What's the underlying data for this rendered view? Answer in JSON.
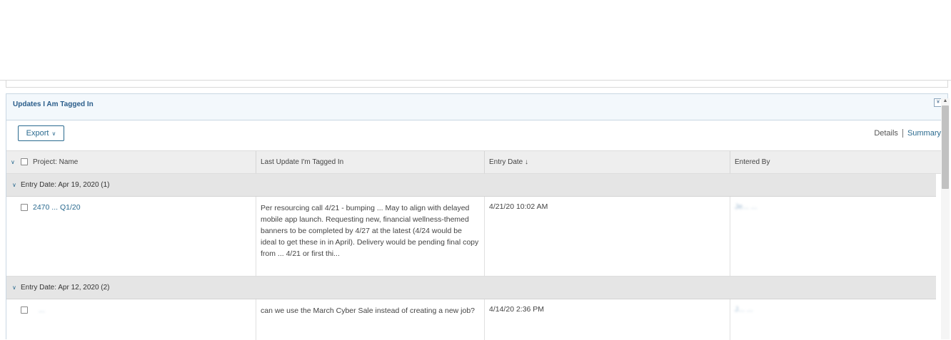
{
  "panel": {
    "title": "Updates I Am Tagged In",
    "collapse_icon": "double-chevron-up-icon"
  },
  "toolbar": {
    "export_label": "Export",
    "details_label": "Details",
    "summary_label": "Summary"
  },
  "grid": {
    "columns": [
      {
        "label": "Project: Name"
      },
      {
        "label": "Last Update I'm Tagged In"
      },
      {
        "label": "Entry Date ↓"
      },
      {
        "label": "Entered By"
      }
    ],
    "groups": [
      {
        "label": "Entry Date: Apr 19, 2020 (1)",
        "rows": [
          {
            "project_name": "2470 ... Q1/20",
            "update": "Per resourcing call 4/21 - bumping ... May to align with delayed mobile app launch. Requesting new, financial wellness-themed banners to be completed by 4/27 at the latest (4/24 would be ideal to get these in in April). Delivery would be pending final copy from ... 4/21 or first thi...",
            "entry_date": "4/21/20 10:02 AM",
            "entered_by": "Je... ..."
          }
        ]
      },
      {
        "label": "Entry Date: Apr 12, 2020 (2)",
        "rows": [
          {
            "project_name": "...",
            "update": "can we use the March Cyber Sale instead of creating a new job?",
            "entry_date": "4/14/20 2:36 PM",
            "entered_by": "J... ..."
          }
        ]
      }
    ]
  },
  "colors": {
    "link": "#2a6a8f",
    "header_bg": "#f3f8fc",
    "group_bg": "#e5e5e5"
  }
}
